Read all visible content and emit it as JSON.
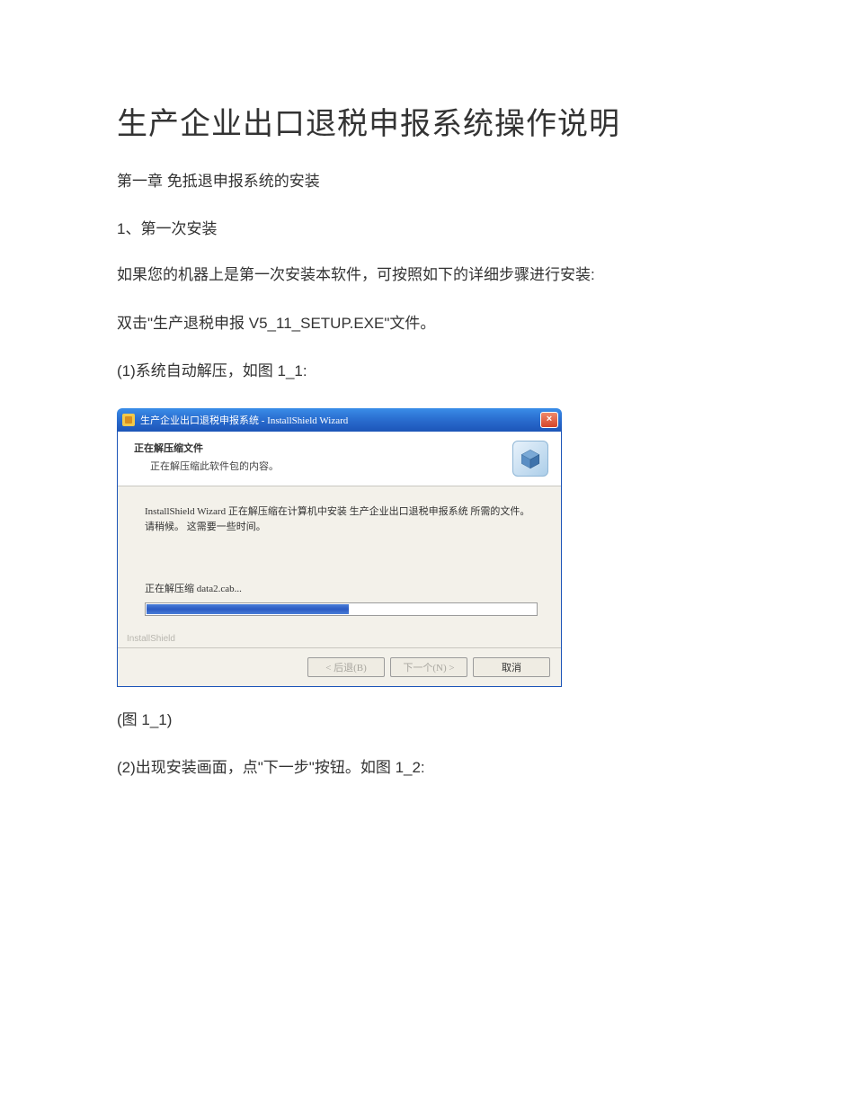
{
  "doc": {
    "title": "生产企业出口退税申报系统操作说明",
    "chapter": "第一章 免抵退申报系统的安装",
    "section": "1、第一次安装",
    "para1": "如果您的机器上是第一次安装本软件，可按照如下的详细步骤进行安装:",
    "para2": "双击\"生产退税申报 V5_11_SETUP.EXE\"文件。",
    "step1": "(1)系统自动解压，如图 1_1:",
    "figLabel": "(图 1_1)",
    "step2": "(2)出现安装画面，点\"下一步\"按钮。如图 1_2:"
  },
  "dialog": {
    "titlebar": "生产企业出口退税申报系统 - InstallShield Wizard",
    "closeGlyph": "×",
    "headerTitle": "正在解压缩文件",
    "headerSub": "正在解压缩此软件包的内容。",
    "message": "InstallShield Wizard 正在解压缩在计算机中安装 生产企业出口退税申报系统 所需的文件。请稍候。 这需要一些时间。",
    "status": "正在解压缩 data2.cab...",
    "brand": "InstallShield",
    "buttons": {
      "back": "< 后退(B)",
      "next": "下一个(N) >",
      "cancel": "取消"
    }
  }
}
